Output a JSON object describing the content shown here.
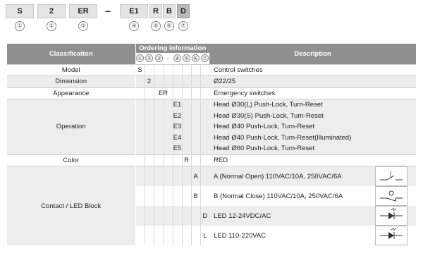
{
  "code": {
    "boxes": [
      "S",
      "2",
      "ER",
      "E1",
      "R",
      "B",
      "D"
    ],
    "dash": "–",
    "circles": [
      "①",
      "②",
      "③",
      "④",
      "⑤",
      "⑥",
      "⑦"
    ]
  },
  "table": {
    "header_classification": "Classification",
    "header_ordering": "Ordering Information",
    "header_description": "Description",
    "ordering_cols": [
      "①",
      "②",
      "③",
      "-",
      "④",
      "⑤",
      "⑥",
      "⑦"
    ],
    "model": {
      "label": "Model",
      "code": "S",
      "desc": "Control switches"
    },
    "dimension": {
      "label": "Dimension",
      "code": "2",
      "desc": "Ø22/25"
    },
    "appearance": {
      "label": "Appearance",
      "code": "ER",
      "desc": "Emergency switches"
    },
    "operation": {
      "label": "Operation",
      "rows": [
        {
          "code": "E1",
          "desc": "Head Ø30(L) Push-Lock, Turn-Reset"
        },
        {
          "code": "E2",
          "desc": "Head Ø30(S) Push-Lock, Turn-Reset"
        },
        {
          "code": "E3",
          "desc": "Head Ø40 Push-Lock, Turn-Reset"
        },
        {
          "code": "E4",
          "desc": "Head Ø40 Push-Lock, Turn-Reset(Illuminated)"
        },
        {
          "code": "E5",
          "desc": "Head Ø60 Push-Lock, Turn-Reset"
        }
      ]
    },
    "color": {
      "label": "Color",
      "code": "R",
      "desc": "RED"
    },
    "contact": {
      "label": "Contact / LED Block",
      "rows": [
        {
          "code": "A",
          "desc": "A (Normal Open) 110VAC/10A, 250VAC/6A",
          "icon": "contact-no-icon"
        },
        {
          "code": "B",
          "desc": "B (Normal Close) 110VAC/10A, 250VAC/6A",
          "icon": "contact-nc-icon"
        },
        {
          "code": "D",
          "desc": "LED 12-24VDC/AC",
          "icon": "led-block-icon"
        },
        {
          "code": "L",
          "desc": "LED 110-220VAC",
          "icon": "led-block-icon"
        }
      ]
    }
  }
}
